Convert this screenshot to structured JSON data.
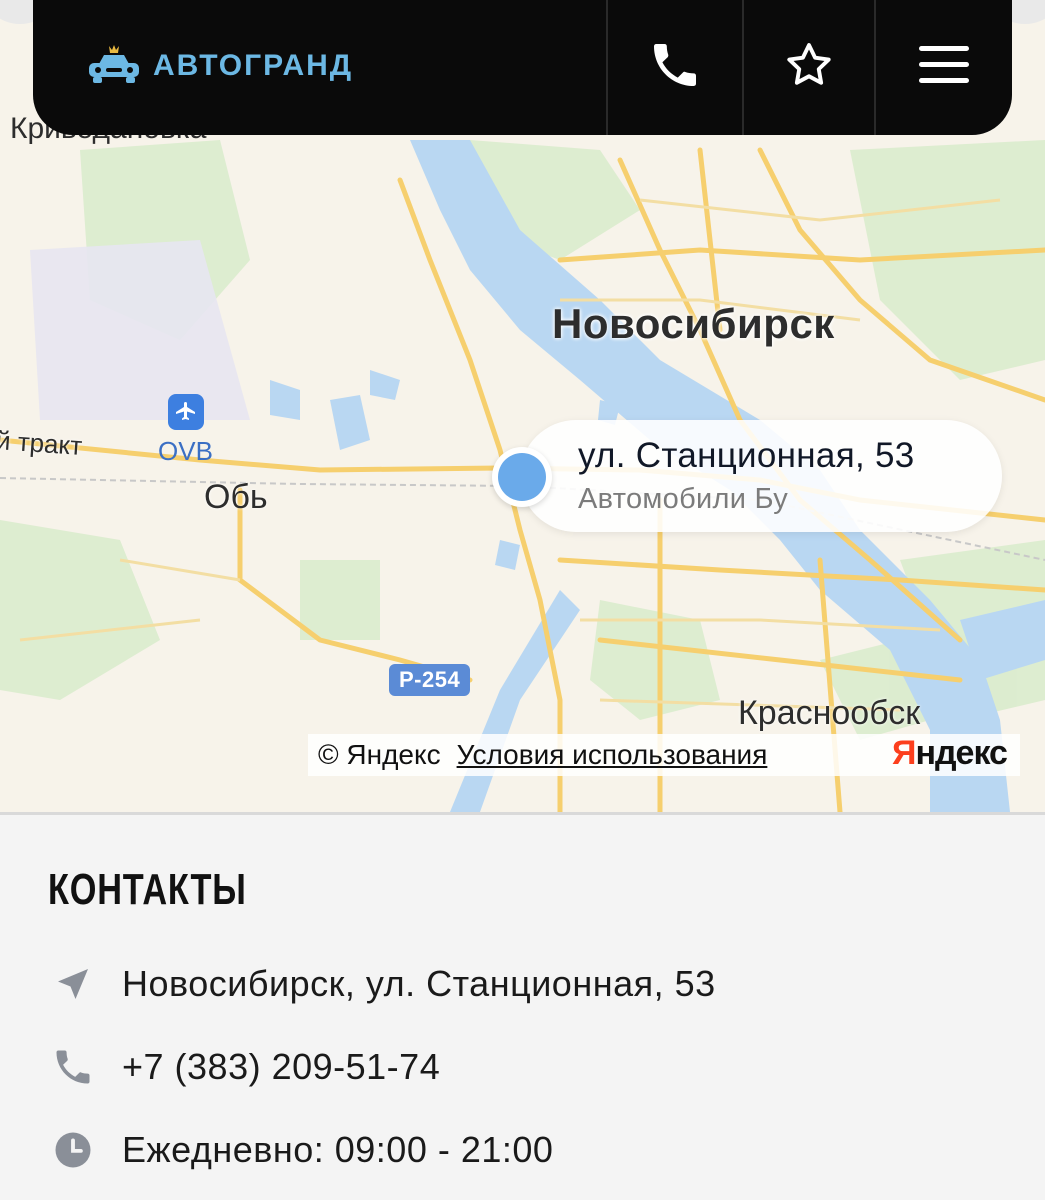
{
  "header": {
    "logo_text": "АВТОГРАНД",
    "icons": [
      "car-logo-icon",
      "phone-icon",
      "star-icon",
      "menu-icon"
    ]
  },
  "map": {
    "city_main": "Новосибирск",
    "city_ob": "Обь",
    "city_krasnoobsk": "Краснообск",
    "city_top_partial": "Криводановка",
    "road_label": "й тракт",
    "airport_code": "OVB",
    "road_badge": "Р-254",
    "marker": {
      "title": "ул. Станционная, 53",
      "subtitle": "Автомобили Бу"
    },
    "copyright": "© Яндекс",
    "terms_link": "Условия использования",
    "yandex_logo_first": "Я",
    "yandex_logo_rest": "ндекс"
  },
  "contacts": {
    "title": "КОНТАКТЫ",
    "address": "Новосибирск, ул. Станционная, 53",
    "phone": "+7 (383) 209-51-74",
    "hours": "Ежедневно: 09:00 - 21:00"
  },
  "colors": {
    "header_bg": "#0a0a0a",
    "logo_accent": "#6cb8e4",
    "marker": "#6aaaea",
    "water": "#b9d7f2",
    "road": "#f6cf6e",
    "park": "#d8ebcb",
    "yandex_red": "#fc3f1d"
  }
}
